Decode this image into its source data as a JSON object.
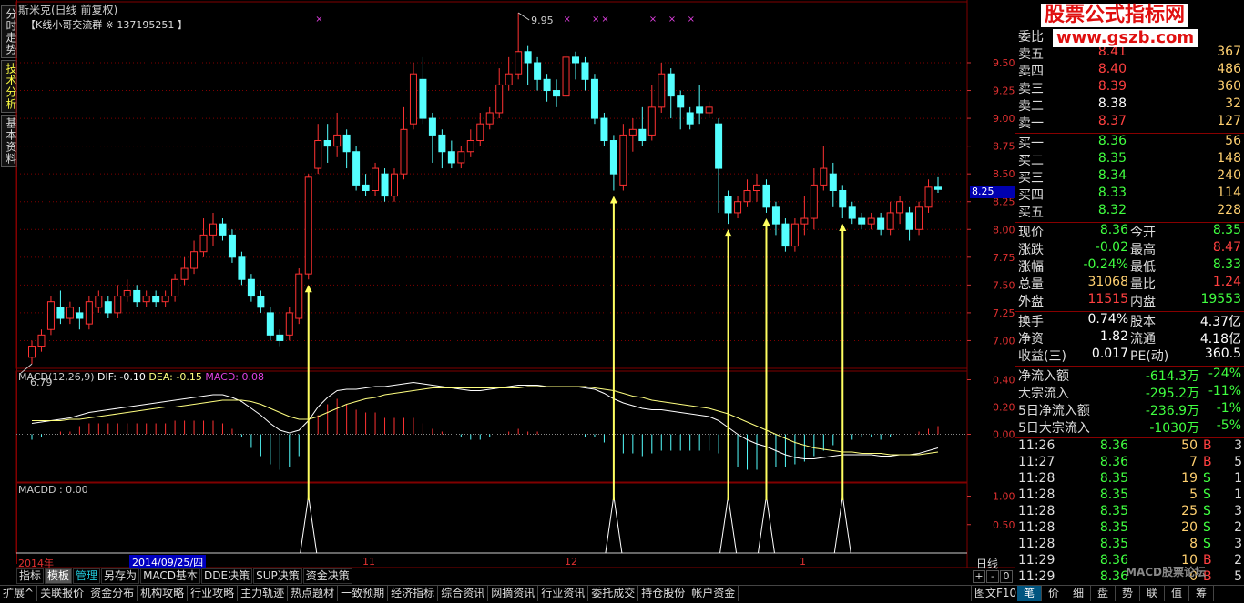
{
  "left_tabs": [
    "分时走势",
    "技术分析",
    "基本资料"
  ],
  "header": {
    "title": "斯米克(日线 前复权)",
    "group_text": "【K线小哥交流群 ※ 137195251 】"
  },
  "price_labels": {
    "high": "9.95",
    "low": "6.79"
  },
  "current_price": "8.25",
  "indicators": {
    "macd_caption": {
      "name": "MACD(12,26,9)",
      "dif": "DIF: -0.10",
      "dea": "DEA: -0.15",
      "macd": "MACD: 0.08"
    },
    "macdd_caption": "MACDD : 0.00"
  },
  "timeline": {
    "year": "2014年",
    "selected_date": "2014/09/25/四",
    "months": [
      "11",
      "12",
      "1"
    ],
    "period": "日线"
  },
  "zoom": [
    "+",
    "-",
    "0"
  ],
  "toolbar": [
    {
      "label": "指标",
      "style": "normal"
    },
    {
      "label": "模板",
      "style": "active"
    },
    {
      "label": "管理",
      "style": "cyan"
    },
    {
      "label": "另存为",
      "style": "normal"
    },
    {
      "label": "MACD基本",
      "style": "normal"
    },
    {
      "label": "DDE决策",
      "style": "normal"
    },
    {
      "label": "SUP决策",
      "style": "normal"
    },
    {
      "label": "资金决策",
      "style": "normal"
    }
  ],
  "bottombar": [
    "扩展^",
    "关联报价",
    "资金分布",
    "机构攻略",
    "行业攻略",
    "主力轨迹",
    "热点题材",
    "一致预期",
    "经济指标",
    "综合资讯",
    "网摘资讯",
    "行业资讯",
    "委托成交",
    "持仓股份",
    "帐户资金",
    "图文F10"
  ],
  "right_tabs": [
    {
      "label": "笔",
      "active": true
    },
    {
      "label": "价",
      "active": false
    },
    {
      "label": "细",
      "active": false
    },
    {
      "label": "盘",
      "active": false
    },
    {
      "label": "势",
      "active": false
    },
    {
      "label": "联",
      "active": false
    },
    {
      "label": "值",
      "active": false
    },
    {
      "label": "筹",
      "active": false
    }
  ],
  "watermark": {
    "title": "股票公式指标网",
    "url": "www.gszb.com",
    "bbs": "MACD股票论坛"
  },
  "quote": {
    "header": "委比",
    "sell": [
      {
        "label": "卖五",
        "price": "8.41",
        "vol": "367"
      },
      {
        "label": "卖四",
        "price": "8.40",
        "vol": "486"
      },
      {
        "label": "卖三",
        "price": "8.39",
        "vol": "360"
      },
      {
        "label": "卖二",
        "price": "8.38",
        "vol": "32"
      },
      {
        "label": "卖一",
        "price": "8.37",
        "vol": "127"
      }
    ],
    "buy": [
      {
        "label": "买一",
        "price": "8.36",
        "vol": "56"
      },
      {
        "label": "买二",
        "price": "8.35",
        "vol": "148"
      },
      {
        "label": "买三",
        "price": "8.34",
        "vol": "240"
      },
      {
        "label": "买四",
        "price": "8.33",
        "vol": "114"
      },
      {
        "label": "买五",
        "price": "8.32",
        "vol": "228"
      }
    ],
    "stats": [
      {
        "l1": "现价",
        "v1": "8.36",
        "l2": "今开",
        "v2": "8.35"
      },
      {
        "l1": "涨跌",
        "v1": "-0.02",
        "l2": "最高",
        "v2": "8.47"
      },
      {
        "l1": "涨幅",
        "v1": "-0.24%",
        "l2": "最低",
        "v2": "8.33"
      },
      {
        "l1": "总量",
        "v1": "31068",
        "l2": "量比",
        "v2": "1.24"
      },
      {
        "l1": "外盘",
        "v1": "11515",
        "l2": "内盘",
        "v2": "19553"
      }
    ],
    "stats2": [
      {
        "l1": "换手",
        "v1": "0.74%",
        "l2": "股本",
        "v2": "4.37亿"
      },
      {
        "l1": "净资",
        "v1": "1.82",
        "l2": "流通",
        "v2": "4.18亿"
      },
      {
        "l1": "收益(三)",
        "v1": "0.017",
        "l2": "PE(动)",
        "v2": "360.5"
      }
    ],
    "flows": [
      {
        "label": "净流入额",
        "value": "-614.3万",
        "pct": "-24%"
      },
      {
        "label": "大宗流入",
        "value": "-295.2万",
        "pct": "-11%"
      },
      {
        "label": "5日净流入额",
        "value": "-236.9万",
        "pct": "-1%"
      },
      {
        "label": "5日大宗流入",
        "value": "-1030万",
        "pct": "-5%"
      }
    ],
    "ticks": [
      {
        "time": "11:26",
        "price": "8.36",
        "vol": "50",
        "side": "B",
        "n": "3"
      },
      {
        "time": "11:27",
        "price": "8.36",
        "vol": "7",
        "side": "B",
        "n": "5"
      },
      {
        "time": "11:28",
        "price": "8.35",
        "vol": "19",
        "side": "S",
        "n": "1"
      },
      {
        "time": "11:28",
        "price": "8.35",
        "vol": "5",
        "side": "S",
        "n": "1"
      },
      {
        "time": "11:28",
        "price": "8.35",
        "vol": "25",
        "side": "S",
        "n": "3"
      },
      {
        "time": "11:28",
        "price": "8.35",
        "vol": "20",
        "side": "S",
        "n": "2"
      },
      {
        "time": "11:28",
        "price": "8.35",
        "vol": "8",
        "side": "S",
        "n": "3"
      },
      {
        "time": "11:29",
        "price": "8.36",
        "vol": "10",
        "side": "B",
        "n": "2"
      },
      {
        "time": "11:29",
        "price": "8.36",
        "vol": "0",
        "side": "B",
        "n": "5"
      }
    ]
  },
  "colors": {
    "up": "#ff3232",
    "down": "#54ffff",
    "grid": "#800000",
    "dif": "#ffffff",
    "dea": "#ffff80",
    "arrow": "#ffff60",
    "macdd": "#ffffff"
  },
  "chart_data": {
    "type": "candlestick",
    "y_ticks": [
      "9.50",
      "9.25",
      "9.00",
      "8.75",
      "8.50",
      "8.25",
      "8.00",
      "7.75",
      "7.50",
      "7.25",
      "7.00"
    ],
    "ylim": [
      6.75,
      9.95
    ],
    "x_labels": [
      "2014年",
      "11",
      "12",
      "1"
    ],
    "candles": [
      [
        6.85,
        6.95,
        6.79,
        7.0
      ],
      [
        6.95,
        7.05,
        6.9,
        7.1
      ],
      [
        7.1,
        7.35,
        7.05,
        7.4
      ],
      [
        7.3,
        7.2,
        7.15,
        7.45
      ],
      [
        7.2,
        7.3,
        7.15,
        7.35
      ],
      [
        7.25,
        7.2,
        7.1,
        7.3
      ],
      [
        7.15,
        7.35,
        7.1,
        7.4
      ],
      [
        7.3,
        7.4,
        7.25,
        7.45
      ],
      [
        7.35,
        7.25,
        7.2,
        7.4
      ],
      [
        7.25,
        7.4,
        7.2,
        7.5
      ],
      [
        7.4,
        7.45,
        7.35,
        7.55
      ],
      [
        7.45,
        7.35,
        7.3,
        7.5
      ],
      [
        7.35,
        7.4,
        7.3,
        7.45
      ],
      [
        7.4,
        7.35,
        7.3,
        7.45
      ],
      [
        7.35,
        7.4,
        7.3,
        7.45
      ],
      [
        7.4,
        7.55,
        7.35,
        7.6
      ],
      [
        7.55,
        7.65,
        7.5,
        7.75
      ],
      [
        7.65,
        7.8,
        7.6,
        7.9
      ],
      [
        7.8,
        7.95,
        7.75,
        8.1
      ],
      [
        7.95,
        8.05,
        7.85,
        8.15
      ],
      [
        8.05,
        7.95,
        7.9,
        8.1
      ],
      [
        7.95,
        7.75,
        7.7,
        8.0
      ],
      [
        7.75,
        7.55,
        7.5,
        7.8
      ],
      [
        7.55,
        7.4,
        7.35,
        7.6
      ],
      [
        7.4,
        7.3,
        7.25,
        7.45
      ],
      [
        7.25,
        7.05,
        7.0,
        7.3
      ],
      [
        7.05,
        7.0,
        6.95,
        7.1
      ],
      [
        7.05,
        7.25,
        7.0,
        7.3
      ],
      [
        7.2,
        7.6,
        7.15,
        7.65
      ],
      [
        7.6,
        8.47,
        7.55,
        8.5
      ],
      [
        8.55,
        8.8,
        8.5,
        8.95
      ],
      [
        8.8,
        8.75,
        8.6,
        8.95
      ],
      [
        8.75,
        8.85,
        8.65,
        9.05
      ],
      [
        8.85,
        8.7,
        8.55,
        8.9
      ],
      [
        8.7,
        8.4,
        8.35,
        8.75
      ],
      [
        8.4,
        8.35,
        8.3,
        8.5
      ],
      [
        8.35,
        8.55,
        8.3,
        8.6
      ],
      [
        8.5,
        8.3,
        8.25,
        8.55
      ],
      [
        8.3,
        8.5,
        8.25,
        8.55
      ],
      [
        8.5,
        8.9,
        8.45,
        9.1
      ],
      [
        8.95,
        9.4,
        8.9,
        9.5
      ],
      [
        9.35,
        9.0,
        8.95,
        9.55
      ],
      [
        9.0,
        8.85,
        8.6,
        9.05
      ],
      [
        8.85,
        8.7,
        8.55,
        8.9
      ],
      [
        8.7,
        8.6,
        8.55,
        8.8
      ],
      [
        8.6,
        8.7,
        8.55,
        8.75
      ],
      [
        8.7,
        8.8,
        8.65,
        8.9
      ],
      [
        8.8,
        8.95,
        8.75,
        9.05
      ],
      [
        8.95,
        9.05,
        8.9,
        9.1
      ],
      [
        9.05,
        9.3,
        9.0,
        9.45
      ],
      [
        9.3,
        9.4,
        9.25,
        9.55
      ],
      [
        9.4,
        9.6,
        9.35,
        9.95
      ],
      [
        9.6,
        9.5,
        9.3,
        9.65
      ],
      [
        9.5,
        9.35,
        9.25,
        9.55
      ],
      [
        9.35,
        9.25,
        9.15,
        9.4
      ],
      [
        9.25,
        9.2,
        9.1,
        9.35
      ],
      [
        9.2,
        9.55,
        9.15,
        9.6
      ],
      [
        9.55,
        9.5,
        9.35,
        9.6
      ],
      [
        9.5,
        9.35,
        9.25,
        9.55
      ],
      [
        9.35,
        9.0,
        8.95,
        9.4
      ],
      [
        9.0,
        8.8,
        8.75,
        9.05
      ],
      [
        8.8,
        8.5,
        8.35,
        8.85
      ],
      [
        8.4,
        8.85,
        8.35,
        8.95
      ],
      [
        8.85,
        8.9,
        8.7,
        9.0
      ],
      [
        8.9,
        8.8,
        8.75,
        9.1
      ],
      [
        8.85,
        9.1,
        8.8,
        9.3
      ],
      [
        9.1,
        9.4,
        9.05,
        9.5
      ],
      [
        9.4,
        9.2,
        9.0,
        9.45
      ],
      [
        9.2,
        9.1,
        8.9,
        9.25
      ],
      [
        9.05,
        8.95,
        8.9,
        9.1
      ],
      [
        9.1,
        9.05,
        8.95,
        9.3
      ],
      [
        9.05,
        9.1,
        9.0,
        9.15
      ],
      [
        8.95,
        8.55,
        8.15,
        9.0
      ],
      [
        8.3,
        8.15,
        8.05,
        8.35
      ],
      [
        8.15,
        8.25,
        8.1,
        8.3
      ],
      [
        8.25,
        8.35,
        8.2,
        8.45
      ],
      [
        8.35,
        8.4,
        8.25,
        8.5
      ],
      [
        8.4,
        8.2,
        8.15,
        8.45
      ],
      [
        8.2,
        8.05,
        7.95,
        8.25
      ],
      [
        8.05,
        7.85,
        7.8,
        8.1
      ],
      [
        7.85,
        8.05,
        7.8,
        8.1
      ],
      [
        8.05,
        8.1,
        7.95,
        8.3
      ],
      [
        8.1,
        8.4,
        8.0,
        8.55
      ],
      [
        8.4,
        8.55,
        8.35,
        8.75
      ],
      [
        8.5,
        8.35,
        8.2,
        8.6
      ],
      [
        8.35,
        8.2,
        8.1,
        8.4
      ],
      [
        8.2,
        8.1,
        8.05,
        8.25
      ],
      [
        8.1,
        8.05,
        8.0,
        8.15
      ],
      [
        8.05,
        8.1,
        8.0,
        8.15
      ],
      [
        8.1,
        8.0,
        7.95,
        8.15
      ],
      [
        8.0,
        8.15,
        7.95,
        8.25
      ],
      [
        8.15,
        8.25,
        8.05,
        8.3
      ],
      [
        8.15,
        8.0,
        7.9,
        8.2
      ],
      [
        8.0,
        8.2,
        7.95,
        8.25
      ],
      [
        8.2,
        8.38,
        8.15,
        8.45
      ],
      [
        8.38,
        8.36,
        8.33,
        8.47
      ]
    ],
    "macd": {
      "ylim": [
        -0.35,
        0.45
      ],
      "y_ticks": [
        "0.40",
        "0.20",
        "0.00"
      ],
      "dif": [
        0.08,
        0.09,
        0.1,
        0.11,
        0.12,
        0.14,
        0.16,
        0.17,
        0.18,
        0.19,
        0.2,
        0.21,
        0.22,
        0.23,
        0.24,
        0.25,
        0.26,
        0.27,
        0.28,
        0.29,
        0.29,
        0.27,
        0.24,
        0.19,
        0.14,
        0.08,
        0.03,
        0.01,
        0.03,
        0.1,
        0.2,
        0.27,
        0.32,
        0.33,
        0.33,
        0.34,
        0.35,
        0.35,
        0.36,
        0.37,
        0.38,
        0.37,
        0.36,
        0.35,
        0.34,
        0.33,
        0.32,
        0.32,
        0.33,
        0.34,
        0.35,
        0.36,
        0.36,
        0.36,
        0.35,
        0.35,
        0.35,
        0.35,
        0.34,
        0.33,
        0.3,
        0.26,
        0.23,
        0.21,
        0.19,
        0.18,
        0.18,
        0.17,
        0.16,
        0.15,
        0.14,
        0.13,
        0.1,
        0.05,
        0.0,
        -0.04,
        -0.07,
        -0.09,
        -0.12,
        -0.15,
        -0.17,
        -0.18,
        -0.18,
        -0.17,
        -0.16,
        -0.15,
        -0.15,
        -0.15,
        -0.15,
        -0.16,
        -0.16,
        -0.15,
        -0.15,
        -0.14,
        -0.12,
        -0.1
      ],
      "dea": [
        0.1,
        0.1,
        0.1,
        0.1,
        0.11,
        0.11,
        0.12,
        0.13,
        0.14,
        0.15,
        0.16,
        0.17,
        0.18,
        0.19,
        0.2,
        0.2,
        0.21,
        0.22,
        0.23,
        0.24,
        0.25,
        0.25,
        0.25,
        0.24,
        0.22,
        0.19,
        0.16,
        0.13,
        0.11,
        0.11,
        0.13,
        0.16,
        0.19,
        0.22,
        0.24,
        0.26,
        0.27,
        0.29,
        0.3,
        0.31,
        0.32,
        0.33,
        0.34,
        0.34,
        0.34,
        0.34,
        0.34,
        0.34,
        0.34,
        0.34,
        0.34,
        0.34,
        0.35,
        0.35,
        0.35,
        0.35,
        0.35,
        0.35,
        0.35,
        0.34,
        0.33,
        0.32,
        0.3,
        0.28,
        0.27,
        0.25,
        0.24,
        0.23,
        0.22,
        0.21,
        0.2,
        0.19,
        0.17,
        0.15,
        0.12,
        0.09,
        0.06,
        0.03,
        0.0,
        -0.03,
        -0.06,
        -0.08,
        -0.1,
        -0.11,
        -0.12,
        -0.13,
        -0.13,
        -0.14,
        -0.14,
        -0.14,
        -0.15,
        -0.15,
        -0.15,
        -0.15,
        -0.14,
        -0.13
      ]
    },
    "macdd_signal_indices": [
      29,
      61,
      73,
      77,
      85
    ],
    "macdd_ylim": [
      0,
      1.2
    ],
    "macdd_y_ticks": [
      "1.00",
      "0.50"
    ],
    "markers_top": [
      30,
      56,
      59,
      60,
      65,
      67,
      69
    ]
  }
}
